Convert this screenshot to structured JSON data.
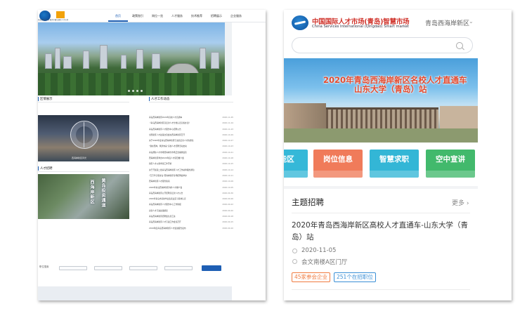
{
  "desktop": {
    "logo_text_1": "西海岸新区人才服务中心",
    "logo_text_2": "青岛国际人才市场",
    "nav": [
      "首页",
      "政策指引",
      "岗位一览",
      "人才服务",
      "技术推荐",
      "招聘展示",
      "企业服务"
    ],
    "section_left": "区情展示",
    "section_left2": "人才招聘",
    "ferris_caption": "西海岸新区风光",
    "aerial_text_1": "西海岸新区",
    "aerial_text_2": "黄岛投资通道",
    "section_right": "人才工作动态",
    "news": [
      {
        "title": "青岛西海岸新区2020年高校人才直通车",
        "date": "2020-11-05"
      },
      {
        "title": "《青岛西海岸新区高层次人才分类认定实施办法》",
        "date": "2020-11-04"
      },
      {
        "title": "青岛西海岸新区人才服务中心招聘公告",
        "date": "2020-11-03"
      },
      {
        "title": "全国新区人才政策交流会在西海岸新区召开",
        "date": "2020-10-29"
      },
      {
        "title": "关于2020年度青岛西海岸新区引进高层次人才的通知",
        "date": "2020-10-27"
      },
      {
        "title": "“我在西岸，筑梦未来”高校人才招聘活动启动",
        "date": "2020-10-23"
      },
      {
        "title": "青岛国际人才市场西海岸分市场正式揭牌运营",
        "date": "2020-10-21"
      },
      {
        "title": "西海岸新区举办2020年度人才项目推介会",
        "date": "2020-10-18"
      },
      {
        "title": "新区人才公寓申请工作开始",
        "date": "2020-10-15"
      },
      {
        "title": "关于开展第二批青岛西海岸新区人才工作站申报的通知",
        "date": "2020-10-14"
      },
      {
        "title": "“百万学子留青岛”西海岸新区专场招聘会举办",
        "date": "2020-10-11"
      },
      {
        "title": "西海岸新区人才服务指南",
        "date": "2020-10-09"
      },
      {
        "title": "2020年青岛西海岸新区海外人才推介会",
        "date": "2020-10-05"
      },
      {
        "title": "青岛西海岸新区公开招聘高层次人才公告",
        "date": "2020-09-30"
      },
      {
        "title": "2020年青岛市高校毕业生就业见习基地认定",
        "date": "2020-09-26"
      },
      {
        "title": "青岛西海岸新区人才服务中心工作简报",
        "date": "2020-09-22"
      },
      {
        "title": "双创人才引进政策解读",
        "date": "2020-09-20"
      },
      {
        "title": "青岛西海岸新区招聘会信息汇总",
        "date": "2020-09-18"
      },
      {
        "title": "青岛西海岸新区人才引进工作会议召开",
        "date": "2020-09-15"
      },
      {
        "title": "2019年度青岛西海岸新区人才发展报告发布",
        "date": "2020-09-10"
      }
    ],
    "search_label": "职位搜索"
  },
  "mobile": {
    "logo_cn": "中国国际人才市场(青岛)智慧市场",
    "logo_en": "China Services International (Qingdao) Smart market",
    "location": "青岛西海岸新区",
    "search_placeholder": "",
    "banner_line1": "2020年青岛西海岸新区名校人才直通车",
    "banner_line2": "山东大学（青岛）站",
    "categories": [
      {
        "label": "功能区",
        "color": "#35b8d8"
      },
      {
        "label": "岗位信息",
        "color": "#f07b5a"
      },
      {
        "label": "智慧求职",
        "color": "#33b6d6"
      },
      {
        "label": "空中宣讲",
        "color": "#42b96c"
      }
    ],
    "section_title": "主题招聘",
    "more_label": "更多",
    "job": {
      "title": "2020年青岛西海岸新区高校人才直通车-山东大学（青岛）站",
      "date": "2020-11-05",
      "location": "会文南楼A区门厅",
      "tag_companies": "45家参会企业",
      "tag_positions": "251个在招职位"
    },
    "colors": {
      "accent_red": "#d0342c",
      "tag_orange": "#f07b3f",
      "tag_blue": "#3a8fd6"
    }
  }
}
